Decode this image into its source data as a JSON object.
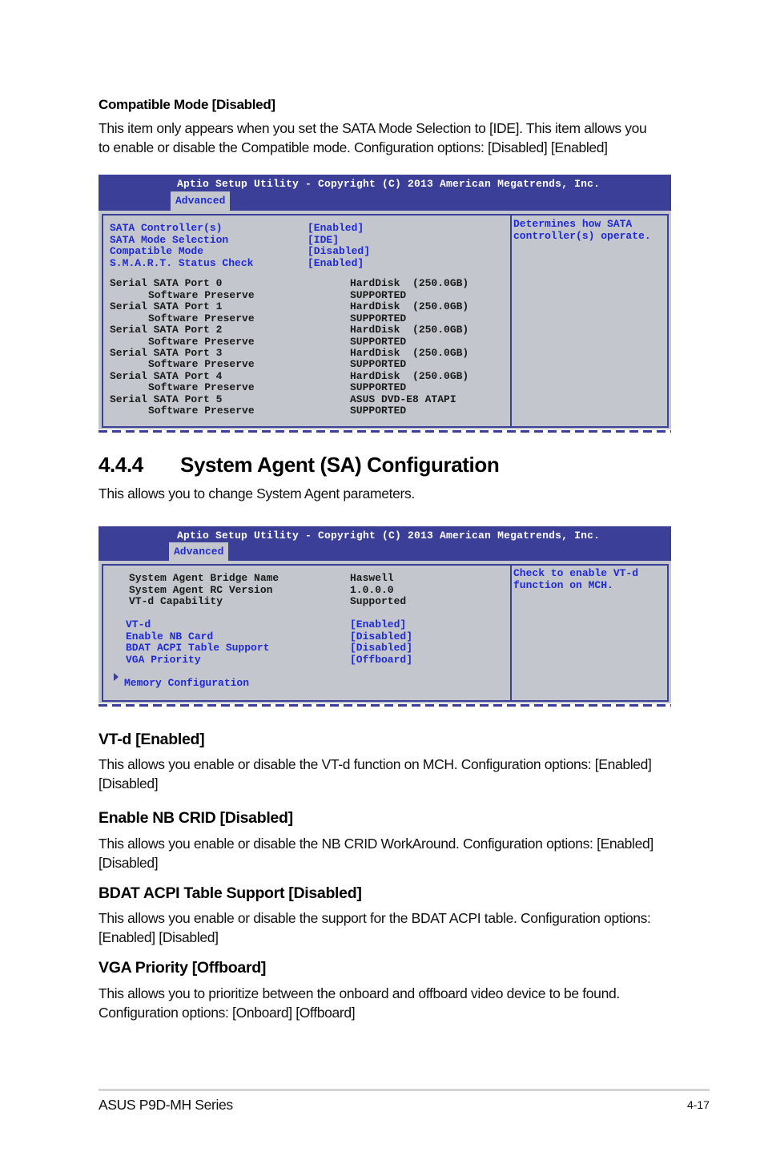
{
  "intro": {
    "heading": "Compatible Mode [Disabled]",
    "lines": [
      "This item only appears when you set the SATA Mode Selection to [IDE]. This item allows you",
      "to enable or disable the Compatible mode. Configuration options: [Disabled] [Enabled]"
    ]
  },
  "bios1": {
    "title": "Aptio Setup Utility - Copyright (C) 2013 American Megatrends, Inc.",
    "tab": "Advanced",
    "settings": [
      {
        "label": "SATA Controller(s)",
        "value": "[Enabled]"
      },
      {
        "label": "SATA Mode Selection",
        "value": "[IDE]"
      },
      {
        "label": "Compatible Mode",
        "value": "[Disabled]"
      },
      {
        "label": "S.M.A.R.T. Status Check",
        "value": "[Enabled]"
      }
    ],
    "ports": [
      {
        "label": "Serial SATA Port 0",
        "device": "HardDisk  (250.0GB)",
        "sub_label": "Software Preserve",
        "sub_value": "SUPPORTED"
      },
      {
        "label": "Serial SATA Port 1",
        "device": "HardDisk  (250.0GB)",
        "sub_label": "Software Preserve",
        "sub_value": "SUPPORTED"
      },
      {
        "label": "Serial SATA Port 2",
        "device": "HardDisk  (250.0GB)",
        "sub_label": "Software Preserve",
        "sub_value": "SUPPORTED"
      },
      {
        "label": "Serial SATA Port 3",
        "device": "HardDisk  (250.0GB)",
        "sub_label": "Software Preserve",
        "sub_value": "SUPPORTED"
      },
      {
        "label": "Serial SATA Port 4",
        "device": "HardDisk  (250.0GB)",
        "sub_label": "Software Preserve",
        "sub_value": "SUPPORTED"
      },
      {
        "label": "Serial SATA Port 5",
        "device": "ASUS DVD-E8 ATAPI",
        "sub_label": "Software Preserve",
        "sub_value": "SUPPORTED"
      }
    ],
    "help": [
      "Determines how SATA",
      "controller(s) operate."
    ]
  },
  "section": {
    "number": "4.4.4",
    "title": "System Agent (SA) Configuration",
    "description": "This allows you to change System Agent parameters."
  },
  "bios2": {
    "title": "Aptio Setup Utility - Copyright (C) 2013 American Megatrends, Inc.",
    "tab": "Advanced",
    "info": [
      {
        "label": "System Agent Bridge Name",
        "value": "Haswell"
      },
      {
        "label": "System Agent RC Version",
        "value": "1.0.0.0"
      },
      {
        "label": "VT-d Capability",
        "value": "Supported"
      }
    ],
    "settings": [
      {
        "label": "VT-d",
        "value": "[Enabled]"
      },
      {
        "label": "Enable NB Card",
        "value": "[Disabled]"
      },
      {
        "label": "BDAT ACPI Table Support",
        "value": "[Disabled]"
      },
      {
        "label": "VGA Priority",
        "value": "[Offboard]"
      }
    ],
    "submenu": "Memory Configuration",
    "help": [
      "Check to enable VT-d",
      "function on MCH."
    ]
  },
  "items": [
    {
      "heading": "VT-d [Enabled]",
      "lines": [
        "This allows you enable or disable the VT-d function on MCH. Configuration options: [Enabled]",
        "[Disabled]"
      ]
    },
    {
      "heading": "Enable NB CRID [Disabled]",
      "lines": [
        "This allows you enable or disable the NB CRID WorkAround. Configuration options: [Enabled]",
        "[Disabled]"
      ]
    },
    {
      "heading": "BDAT ACPI Table Support [Disabled]",
      "lines": [
        "This allows you enable or disable the support for the BDAT ACPI table. Configuration options:",
        "[Enabled] [Disabled]"
      ]
    },
    {
      "heading": "VGA Priority [Offboard]",
      "lines": [
        "This allows you to prioritize between the onboard and offboard video device to be found.",
        "Configuration options: [Onboard] [Offboard]"
      ]
    }
  ],
  "footer": {
    "product": "ASUS P9D-MH Series",
    "page": "4-17"
  }
}
